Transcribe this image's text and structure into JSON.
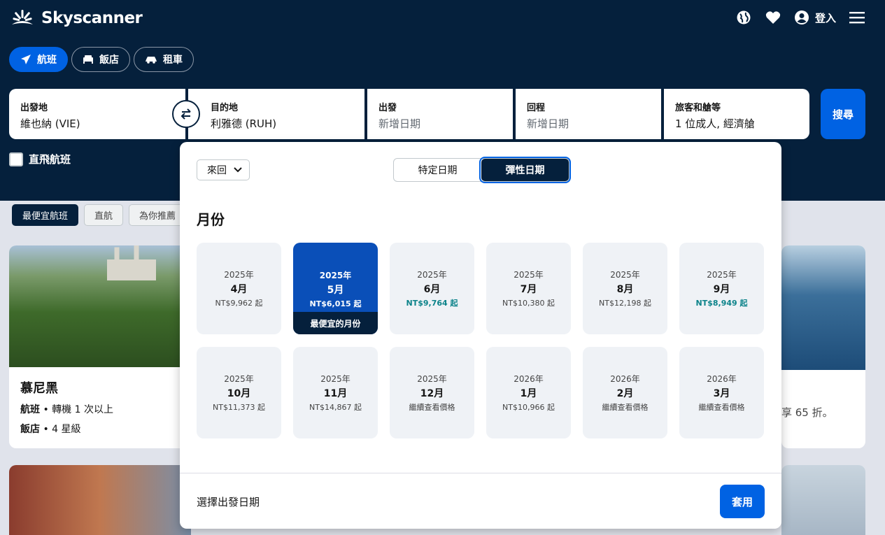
{
  "brand": {
    "name": "Skyscanner"
  },
  "topnav": {
    "login": "登入"
  },
  "tabs": [
    {
      "label": "航班",
      "icon": "plane-icon"
    },
    {
      "label": "飯店",
      "icon": "bed-icon"
    },
    {
      "label": "租車",
      "icon": "car-icon"
    }
  ],
  "search": {
    "origin": {
      "label": "出發地",
      "value": "維也納 (VIE)"
    },
    "destination": {
      "label": "目的地",
      "value": "利雅德 (RUH)"
    },
    "depart": {
      "label": "出發",
      "placeholder": "新增日期"
    },
    "return": {
      "label": "回程",
      "placeholder": "新增日期"
    },
    "travellers": {
      "label": "旅客和艙等",
      "value": "1 位成人, 經濟艙"
    },
    "button": "搜尋",
    "direct_label": "直飛航班"
  },
  "background": {
    "chips": [
      "最便宜航班",
      "直航",
      "為你推薦"
    ],
    "card1": {
      "city": "慕尼黑",
      "flight_label": "航班",
      "flight_text": "轉機 1 次以上",
      "hotel_label": "飯店",
      "hotel_text": "4 星級"
    },
    "card2": {
      "promo": "享 65 折。"
    }
  },
  "popup": {
    "trip_type": "來回",
    "segment": {
      "specific": "特定日期",
      "flexible": "彈性日期"
    },
    "months_title": "月份",
    "months": [
      {
        "year": "2025年",
        "month": "4月",
        "price": "NT$9,962 起"
      },
      {
        "year": "2025年",
        "month": "5月",
        "price": "NT$6,015 起",
        "badge": "最便宜的月份"
      },
      {
        "year": "2025年",
        "month": "6月",
        "price": "NT$9,764 起"
      },
      {
        "year": "2025年",
        "month": "7月",
        "price": "NT$10,380 起"
      },
      {
        "year": "2025年",
        "month": "8月",
        "price": "NT$12,198 起"
      },
      {
        "year": "2025年",
        "month": "9月",
        "price": "NT$8,949 起"
      },
      {
        "year": "2025年",
        "month": "10月",
        "price": "NT$11,373 起"
      },
      {
        "year": "2025年",
        "month": "11月",
        "price": "NT$14,867 起"
      },
      {
        "year": "2025年",
        "month": "12月",
        "price": "繼續查看價格"
      },
      {
        "year": "2026年",
        "month": "1月",
        "price": "NT$10,966 起"
      },
      {
        "year": "2026年",
        "month": "2月",
        "price": "繼續查看價格"
      },
      {
        "year": "2026年",
        "month": "3月",
        "price": "繼續查看價格"
      }
    ],
    "footer_text": "選擇出發日期",
    "apply": "套用"
  },
  "colors": {
    "navy": "#05203c",
    "blue": "#0062e3",
    "cheap": "#0c838a"
  }
}
